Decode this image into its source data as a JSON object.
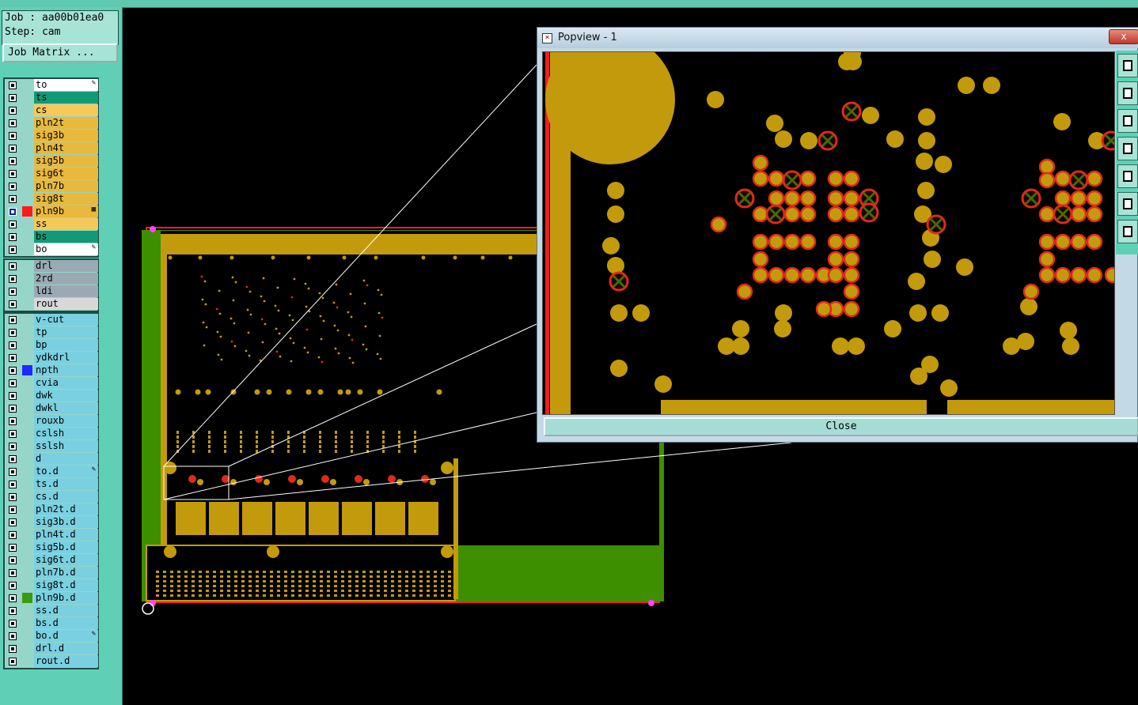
{
  "job": {
    "job_line": "Job : aa00b01ea0",
    "step_line": "Step: cam",
    "matrix_button": "Job Matrix ..."
  },
  "layer_groups": [
    {
      "layers": [
        {
          "name": "to",
          "color": "#ffffff",
          "active": false,
          "marker": "pen"
        },
        {
          "name": "ts",
          "color": "#129a77",
          "active": false
        },
        {
          "name": "cs",
          "color": "#f5c85a",
          "active": false
        },
        {
          "name": "pln2t",
          "color": "#e8b93d",
          "active": false
        },
        {
          "name": "sig3b",
          "color": "#e8b93d",
          "active": false
        },
        {
          "name": "pln4t",
          "color": "#e8b93d",
          "active": false
        },
        {
          "name": "sig5b",
          "color": "#e8b93d",
          "active": false
        },
        {
          "name": "sig6t",
          "color": "#e8b93d",
          "active": false
        },
        {
          "name": "pln7b",
          "color": "#e8b93d",
          "active": false
        },
        {
          "name": "sig8t",
          "color": "#e8b93d",
          "active": false
        },
        {
          "name": "pln9b",
          "color": "#e8b93d",
          "active": true,
          "swatch": "#ff1a1a",
          "marker": "grid"
        },
        {
          "name": "ss",
          "color": "#f5c85a",
          "active": false
        },
        {
          "name": "bs",
          "color": "#129a77",
          "active": false
        },
        {
          "name": "bo",
          "color": "#ffffff",
          "active": false,
          "marker": "pen"
        }
      ]
    },
    {
      "layers": [
        {
          "name": "drl",
          "color": "#9aaab5",
          "active": false
        },
        {
          "name": "2rd",
          "color": "#9aaab5",
          "active": false
        },
        {
          "name": "ldi",
          "color": "#9aaab5",
          "active": false
        },
        {
          "name": "rout",
          "color": "#d8d8d8",
          "active": false
        }
      ]
    },
    {
      "layers": [
        {
          "name": "v-cut",
          "color": "#7ad0e0",
          "active": false
        },
        {
          "name": "tp",
          "color": "#7ad0e0",
          "active": false
        },
        {
          "name": "bp",
          "color": "#7ad0e0",
          "active": false
        },
        {
          "name": "ydkdrl",
          "color": "#7ad0e0",
          "active": false
        },
        {
          "name": "npth",
          "color": "#7ad0e0",
          "active": false,
          "swatch": "#1a2cff"
        },
        {
          "name": "cvia",
          "color": "#7ad0e0",
          "active": false
        },
        {
          "name": "dwk",
          "color": "#7ad0e0",
          "active": false
        },
        {
          "name": "dwkl",
          "color": "#7ad0e0",
          "active": false
        },
        {
          "name": "rouxb",
          "color": "#7ad0e0",
          "active": false
        },
        {
          "name": "cslsh",
          "color": "#7ad0e0",
          "active": false
        },
        {
          "name": "sslsh",
          "color": "#7ad0e0",
          "active": false
        },
        {
          "name": "d",
          "color": "#7ad0e0",
          "active": false
        },
        {
          "name": "to.d",
          "color": "#7ad0e0",
          "active": false,
          "marker": "pen"
        },
        {
          "name": "ts.d",
          "color": "#7ad0e0",
          "active": false
        },
        {
          "name": "cs.d",
          "color": "#7ad0e0",
          "active": false
        },
        {
          "name": "pln2t.d",
          "color": "#7ad0e0",
          "active": false
        },
        {
          "name": "sig3b.d",
          "color": "#7ad0e0",
          "active": false
        },
        {
          "name": "pln4t.d",
          "color": "#7ad0e0",
          "active": false
        },
        {
          "name": "sig5b.d",
          "color": "#7ad0e0",
          "active": false
        },
        {
          "name": "sig6t.d",
          "color": "#7ad0e0",
          "active": false
        },
        {
          "name": "pln7b.d",
          "color": "#7ad0e0",
          "active": false
        },
        {
          "name": "sig8t.d",
          "color": "#7ad0e0",
          "active": false
        },
        {
          "name": "pln9b.d",
          "color": "#7ad0e0",
          "active": false,
          "swatch": "#3a9a10"
        },
        {
          "name": "ss.d",
          "color": "#7ad0e0",
          "active": false
        },
        {
          "name": "bs.d",
          "color": "#7ad0e0",
          "active": false
        },
        {
          "name": "bo.d",
          "color": "#7ad0e0",
          "active": false,
          "marker": "pen"
        },
        {
          "name": "drl.d",
          "color": "#7ad0e0",
          "active": false
        },
        {
          "name": "rout.d",
          "color": "#7ad0e0",
          "active": false
        }
      ]
    }
  ],
  "popview": {
    "title": "Popview - 1",
    "close_label": "Close",
    "close_x": "x"
  },
  "colors": {
    "copper": "#c39a0b",
    "outline": "#ff2020",
    "soldermask": "#3d8f00",
    "panel": "#5fd0b6"
  },
  "side_tools": [
    "zoom-window-icon",
    "pan-up-icon",
    "pan-down-icon",
    "pan-left-icon",
    "pan-right-icon",
    "zoom-fit-icon",
    "zoom-home-icon"
  ]
}
